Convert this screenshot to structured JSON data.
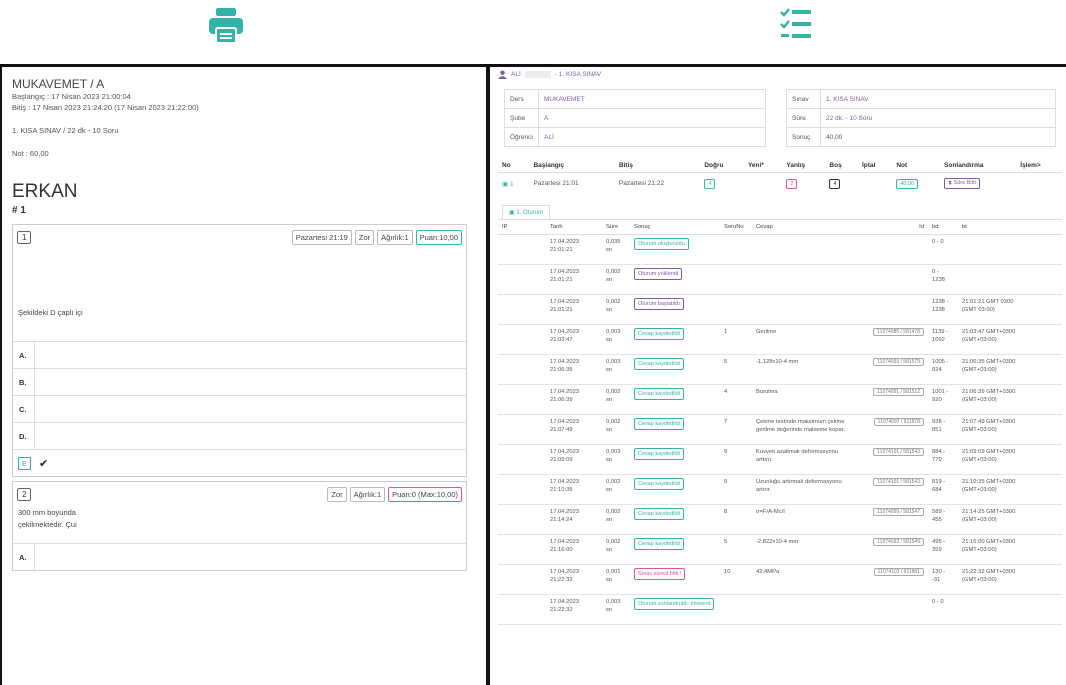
{
  "colors": {
    "accent": "#36b3a8",
    "purple": "#7b5ea7",
    "pink": "#e0568e"
  },
  "icons": {
    "print": "print-icon",
    "checklist": "checklist-icon"
  },
  "exam_sheet": {
    "course": "MUKAVEMET / A",
    "start": "Başlangıç : 17 Nisan 2023 21:00:04",
    "end": "Bitiş : 17 Nisan 2023 21:24:20 (17 Nisan 2023 21:22:00)",
    "exam": "1. KISA SINAV / 22 dk - 10 Soru",
    "grade": "Not : 60,00",
    "student": "ERKAN",
    "student_no": "# 1",
    "questions": [
      {
        "num": "1",
        "time": "Pazartesi 21:19",
        "difficulty": "Zor",
        "weight": "Ağırlık:1",
        "points": "Puan:10,00",
        "text": "Şekildeki  D  çaplı  içi",
        "options": [
          "A.",
          "B.",
          "C.",
          "D."
        ],
        "selected": "E",
        "check": "✔"
      },
      {
        "num": "2",
        "difficulty": "Zor",
        "weight": "Ağırlık:1",
        "points": "Puan:0 (Max:10,00)",
        "text1": "300 mm boyunda",
        "text2": "çekilmektedir. Çui",
        "options": [
          "A."
        ]
      }
    ]
  },
  "panel": {
    "user": "ALİ",
    "exam_title": "- 1. KISA SINAV",
    "left_info": [
      {
        "k": "Ders",
        "v": "MUKAVEMET"
      },
      {
        "k": "Şube",
        "v": "A"
      },
      {
        "k": "Öğrenci",
        "v": "ALİ"
      }
    ],
    "right_info": [
      {
        "k": "Sınav",
        "v": "1. KISA SINAV"
      },
      {
        "k": "Süre",
        "v": "22 dk. - 10 Soru"
      },
      {
        "k": "Sonuç",
        "v": "40,00"
      }
    ],
    "summary_headers": [
      "No",
      "Başlangıç",
      "Bitiş",
      "Doğru",
      "Yeni*",
      "Yanlış",
      "Boş",
      "İptal",
      "Not",
      "Sonlandırma",
      "İşlem>"
    ],
    "summary_row": {
      "no": "1",
      "start": "Pazartesi 21:01",
      "end": "Pazartesi 21:22",
      "correct": "4",
      "new": "",
      "wrong": "2",
      "empty": "4",
      "cancel": "",
      "grade": "40,00",
      "ending": "Süre Bitti"
    },
    "tab": "1. Oturum",
    "log_headers": [
      "IP",
      "Tarih",
      "Süre",
      "Sonuç",
      "SoruNo",
      "Cevap",
      "Id",
      "bd",
      "bt"
    ],
    "log_rows": [
      {
        "date1": "17.04.2023",
        "date2": "21:01:21",
        "dur1": "0,035",
        "dur2": "sn",
        "result": "Oturum oluşturuldu",
        "badge": "",
        "qno": "",
        "answer": "",
        "id": "",
        "bd1": "0 - 0",
        "bd2": "",
        "bt1": "",
        "bt2": ""
      },
      {
        "date1": "17.04.2023",
        "date2": "21:01:21",
        "dur1": "0,002",
        "dur2": "sn",
        "result": "Oturum yüklendi",
        "badge": "purple",
        "qno": "",
        "answer": "",
        "id": "",
        "bd1": "0 -",
        "bd2": "1238",
        "bt1": "",
        "bt2": ""
      },
      {
        "date1": "17.04.2023",
        "date2": "21:01:21",
        "dur1": "0,002",
        "dur2": "sn",
        "result": "Oturum başlatıldı",
        "badge": "purple",
        "qno": "",
        "answer": "",
        "id": "",
        "bd1": "1238 -",
        "bd2": "1238",
        "bt1": "21:01:21 GMT 0300",
        "bt2": "(GMT 03:00)"
      },
      {
        "date1": "17.04.2023",
        "date2": "21:03:47",
        "dur1": "0,003",
        "dur2": "sn",
        "result": "Cevap kaydedildi",
        "badge": "",
        "qno": "1",
        "answer": "Gerilme",
        "id": "11074085 / 581478",
        "bd1": "1139 -",
        "bd2": "1092",
        "bt1": "21:03:47 GMT+0300",
        "bt2": "(GMT+03:00)"
      },
      {
        "date1": "17.04.2023",
        "date2": "21:06:35",
        "dur1": "0,003",
        "dur2": "sn",
        "result": "Cevap kaydedildi",
        "badge": "",
        "qno": "5",
        "answer": "-1.128x10-4 mm",
        "id": "11074093 / 581579",
        "bd1": "1005 -",
        "bd2": "924",
        "bt1": "21:06:35 GMT+0300",
        "bt2": "(GMT+03:00)"
      },
      {
        "date1": "17.04.2023",
        "date2": "21:06:39",
        "dur1": "0,002",
        "dur2": "sn",
        "result": "Cevap kaydedildi",
        "badge": "",
        "qno": "4",
        "answer": "Burulma",
        "id": "11074091 / 581512",
        "bd1": "1001 -",
        "bd2": "920",
        "bt1": "21:06:39 GMT+0300",
        "bt2": "(GMT+03:00)"
      },
      {
        "date1": "17.04.2023",
        "date2": "21:07:49",
        "dur1": "0,002",
        "dur2": "sn",
        "result": "Cevap kaydedildi",
        "badge": "",
        "qno": "7",
        "answer": "Çekme testinde maksimum çekme",
        "answer2": "gerilme değerinde malzeme kopar.",
        "id": "11074097 / 911878",
        "bd1": "938 -",
        "bd2": "851",
        "bt1": "21:07:49 GMT+0300",
        "bt2": "(GMT+03:00)"
      },
      {
        "date1": "17.04.2023",
        "date2": "21:09:09",
        "dur1": "0,003",
        "dur2": "sn",
        "result": "Cevap kaydedildi",
        "badge": "",
        "qno": "9",
        "answer": "Kuvveti azaltmak deformasyonu",
        "answer2": "arttırır.",
        "id": "11074101 / 581543",
        "bd1": "884 -",
        "bd2": "770",
        "bt1": "21:09:09 GMT+0300",
        "bt2": "(GMT+03:00)"
      },
      {
        "date1": "17.04.2023",
        "date2": "21:10:35",
        "dur1": "0,002",
        "dur2": "sn",
        "result": "Cevap kaydedildi",
        "badge": "",
        "qno": "9",
        "answer": "Uzunluğu artırmak deformasyonu",
        "answer2": "artırır.",
        "id": "11074101 / 581543",
        "bd1": "819 -",
        "bd2": "684",
        "bt1": "21:10:35 GMT+0300",
        "bt2": "(GMT+03:00)"
      },
      {
        "date1": "17.04.2023",
        "date2": "21:14:24",
        "dur1": "0,002",
        "dur2": "sn",
        "result": "Cevap kaydedildi",
        "badge": "",
        "qno": "8",
        "answer": "σ=F/A-Mc/I",
        "id": "11074099 / 581547",
        "bd1": "589 -",
        "bd2": "455",
        "bt1": "21:14:25 GMT+0300",
        "bt2": "(GMT+03:00)"
      },
      {
        "date1": "17.04.2023",
        "date2": "21:16:00",
        "dur1": "0,002",
        "dur2": "sn",
        "result": "Cevap kaydedildi",
        "badge": "",
        "qno": "5",
        "answer": "-2.822x10-4 mm",
        "id": "11074093 / 581549",
        "bd1": "495 -",
        "bd2": "359",
        "bt1": "21:16:00 GMT+0300",
        "bt2": "(GMT+03:00)"
      },
      {
        "date1": "17.04.2023",
        "date2": "21:22:32",
        "dur1": "0,001",
        "dur2": "sn",
        "result": "Sınav süresi bitti !",
        "badge": "pink",
        "qno": "10",
        "answer": "42.4MPa",
        "id": "11074103 / 911881",
        "bd1": "130 -",
        "bd2": "-31",
        "bt1": "21:22:32 GMT+0300",
        "bt2": "(GMT+03:00)"
      },
      {
        "date1": "17.04.2023",
        "date2": "21:22:32",
        "dur1": "0,003",
        "dur2": "sn",
        "result": "Oturum sonlandırıldı: timeend",
        "badge": "",
        "qno": "",
        "answer": "",
        "id": "",
        "bd1": "0 - 0",
        "bd2": "",
        "bt1": "",
        "bt2": ""
      }
    ]
  }
}
